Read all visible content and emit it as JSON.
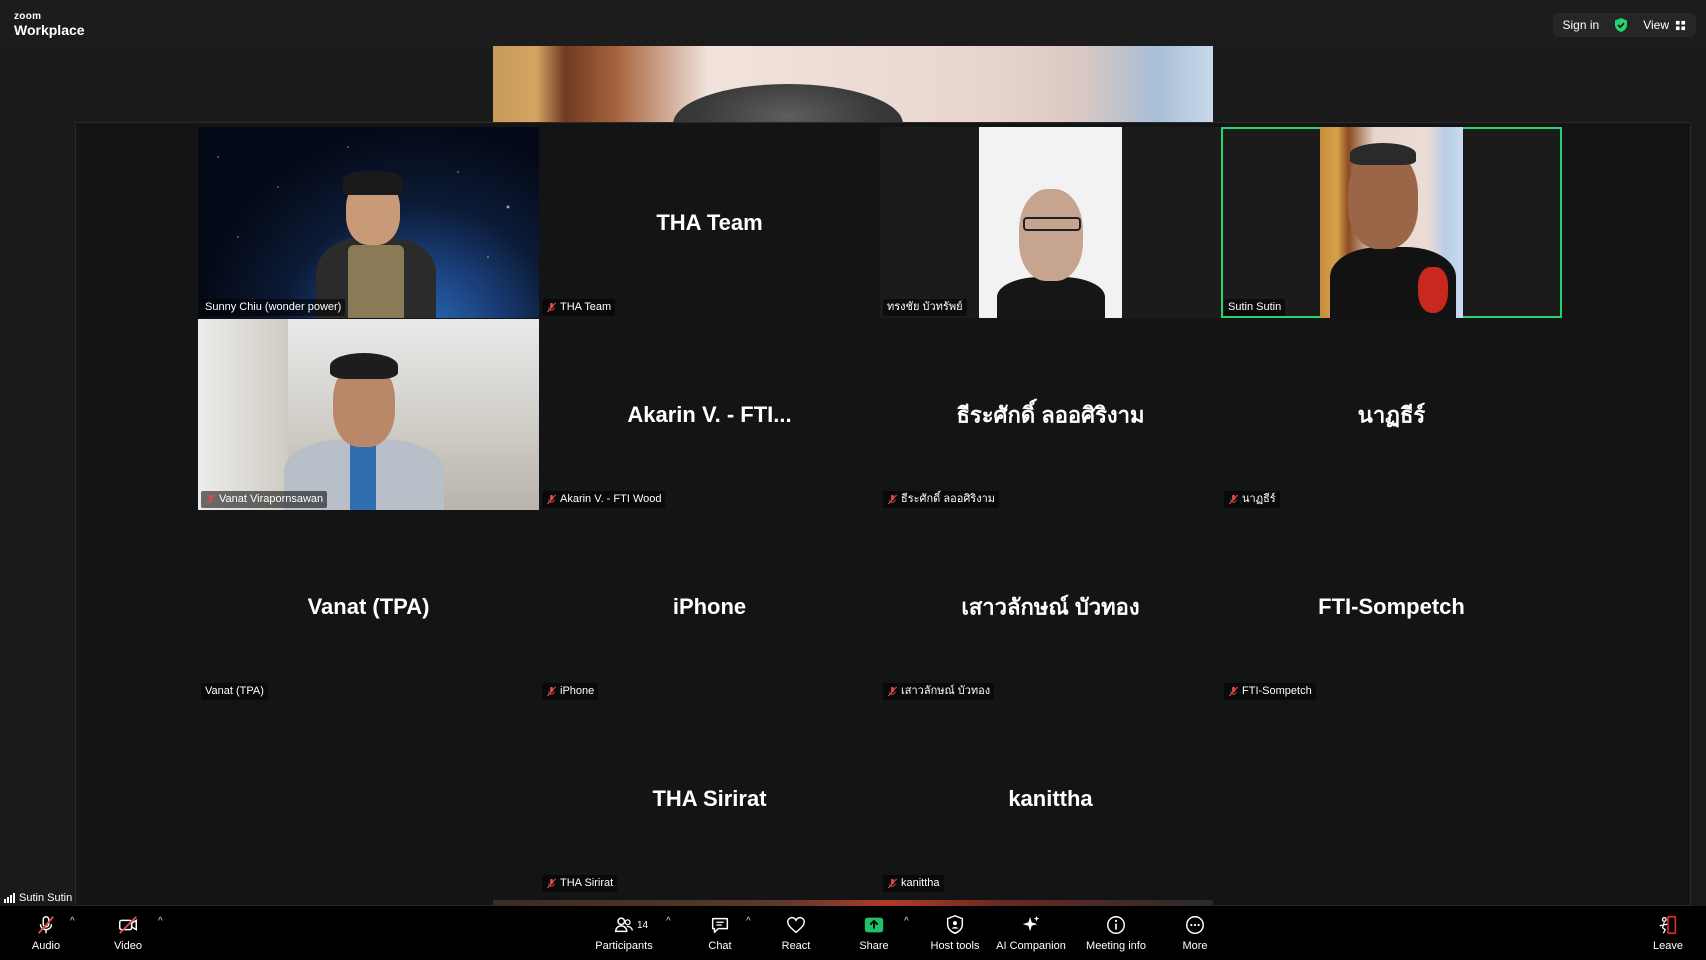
{
  "app": {
    "brand_small": "zoom",
    "brand_large": "Workplace"
  },
  "header": {
    "sign_in": "Sign in",
    "view": "View"
  },
  "tiles": [
    {
      "label": "Sunny Chiu (wonder power)",
      "big_name": "",
      "muted": false,
      "video": "space"
    },
    {
      "label": "THA Team",
      "big_name": "THA Team",
      "muted": true,
      "video": ""
    },
    {
      "label": "ทรงชัย บัวทรัพย์",
      "big_name": "",
      "muted": false,
      "video": "white"
    },
    {
      "label": "Sutin Sutin",
      "big_name": "",
      "muted": false,
      "video": "gold",
      "active": true
    },
    {
      "label": "Vanat Virapornsawan",
      "big_name": "",
      "muted": true,
      "video": "office"
    },
    {
      "label": "Akarin V. - FTI Wood",
      "big_name": "Akarin V. - FTI...",
      "muted": true,
      "video": ""
    },
    {
      "label": "ธีระศักดิ์ ลออศิริงาม",
      "big_name": "ธีระศักดิ์ ลออศิริงาม",
      "muted": true,
      "video": ""
    },
    {
      "label": "นาฏธีร์",
      "big_name": "นาฏธีร์",
      "muted": true,
      "video": ""
    },
    {
      "label": "Vanat (TPA)",
      "big_name": "Vanat (TPA)",
      "muted": false,
      "video": ""
    },
    {
      "label": "iPhone",
      "big_name": "iPhone",
      "muted": true,
      "video": ""
    },
    {
      "label": "เสาวลักษณ์ บัวทอง",
      "big_name": "เสาวลักษณ์ บัวทอง",
      "muted": true,
      "video": ""
    },
    {
      "label": "FTI-Sompetch",
      "big_name": "FTI-Sompetch",
      "muted": true,
      "video": ""
    },
    {
      "label": "THA Sirirat",
      "big_name": "THA Sirirat",
      "muted": true,
      "video": ""
    },
    {
      "label": "kanittha",
      "big_name": "kanittha",
      "muted": true,
      "video": ""
    }
  ],
  "self_view": {
    "name": "Sutin Sutin"
  },
  "toolbar": {
    "audio": "Audio",
    "video": "Video",
    "participants": "Participants",
    "participants_count": "14",
    "chat": "Chat",
    "react": "React",
    "share": "Share",
    "host_tools": "Host tools",
    "ai_companion": "AI Companion",
    "meeting_info": "Meeting info",
    "more": "More",
    "leave": "Leave"
  },
  "colors": {
    "active_speaker": "#27d36b",
    "share_green": "#1fc16b",
    "muted_red": "#e5484d",
    "leave_red": "#e02828"
  }
}
